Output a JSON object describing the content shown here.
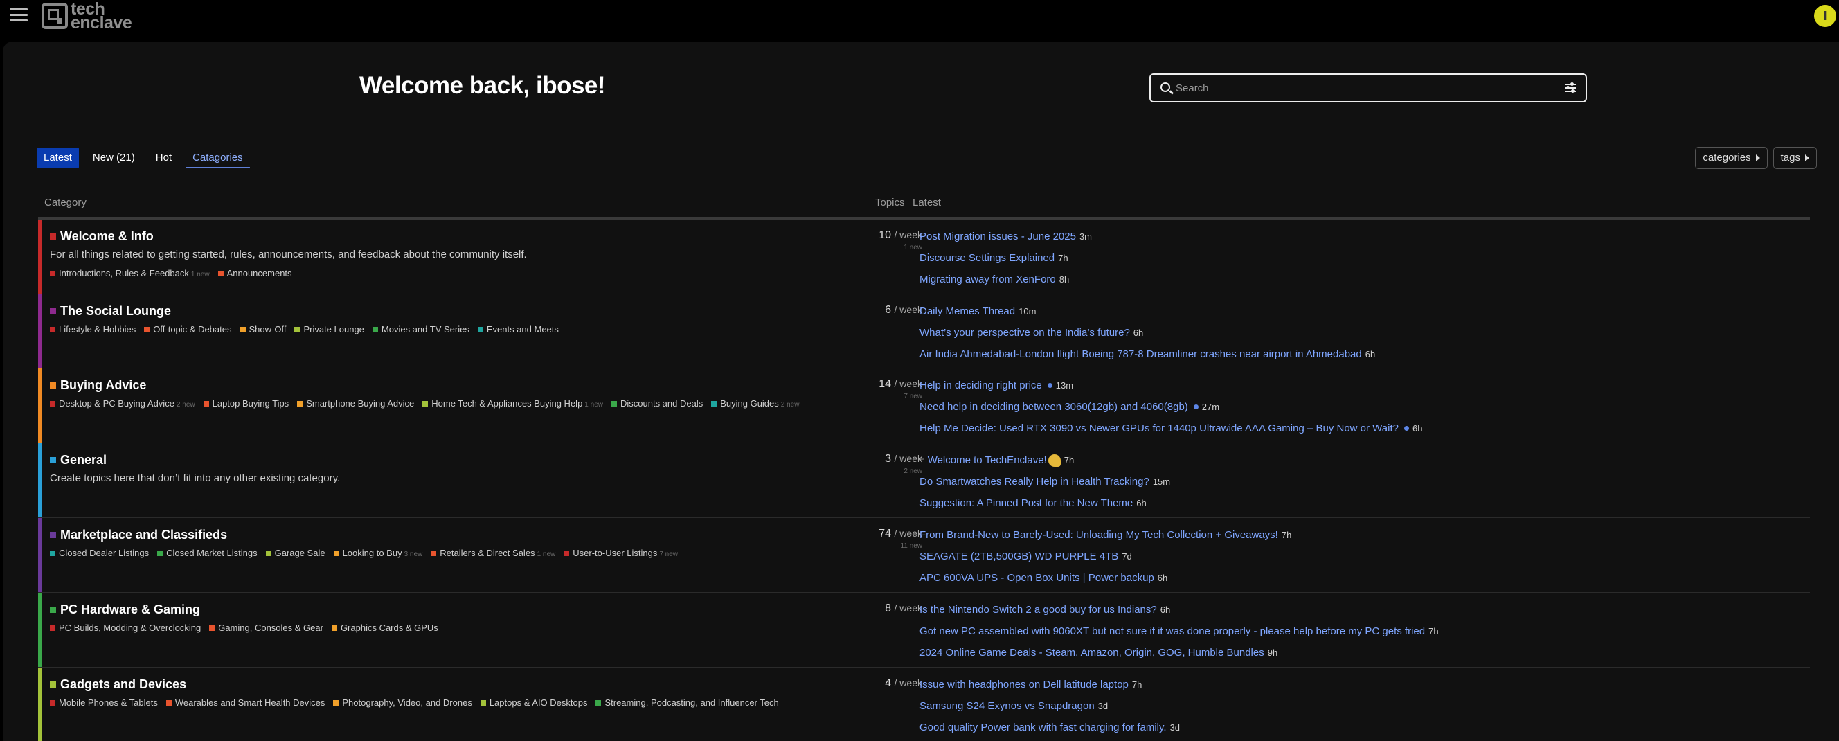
{
  "header": {
    "logo_text_1": "tech",
    "logo_text_2": "enclave",
    "avatar_letter": "I"
  },
  "welcome": "Welcome back, ibose!",
  "search": {
    "placeholder": "Search"
  },
  "tabs": [
    {
      "label": "Latest"
    },
    {
      "label": "New (21)"
    },
    {
      "label": "Hot"
    },
    {
      "label": "Catagories"
    }
  ],
  "crumbs": {
    "categories": "categories",
    "tags": "tags"
  },
  "table": {
    "col_category": "Category",
    "col_topics": "Topics",
    "col_latest": "Latest"
  },
  "categories": [
    {
      "name": "Welcome & Info",
      "color": "#c62a2a",
      "description": "For all things related to getting started, rules, announcements, and feedback about the community itself.",
      "subcategories": [
        {
          "name": "Introductions, Rules & Feedback",
          "color": "#c62a2a",
          "new": "1 new"
        },
        {
          "name": "Announcements",
          "color": "#e8542e",
          "new": ""
        }
      ],
      "topics": "10",
      "per": "/ week",
      "new": "1 new",
      "latest": [
        {
          "title": "Post Migration issues - June 2025",
          "age": "3m"
        },
        {
          "title": "Discourse Settings Explained",
          "age": "7h"
        },
        {
          "title": "Migrating away from XenForo",
          "age": "8h"
        }
      ]
    },
    {
      "name": "The Social Lounge",
      "color": "#8e2a8e",
      "description": "",
      "subcategories": [
        {
          "name": "Lifestyle & Hobbies",
          "color": "#c62a2a",
          "new": ""
        },
        {
          "name": "Off-topic & Debates",
          "color": "#e8542e",
          "new": ""
        },
        {
          "name": "Show-Off",
          "color": "#f0a02a",
          "new": ""
        },
        {
          "name": "Private Lounge",
          "color": "#a3c23a",
          "new": ""
        },
        {
          "name": "Movies and TV Series",
          "color": "#3aa84a",
          "new": ""
        },
        {
          "name": "Events and Meets",
          "color": "#1fa6a0",
          "new": ""
        }
      ],
      "topics": "6",
      "per": "/ week",
      "new": "",
      "latest": [
        {
          "title": "Daily Memes Thread",
          "age": "10m"
        },
        {
          "title": "What’s your perspective on the India’s future?",
          "age": "6h"
        },
        {
          "title": "Air India Ahmedabad-London flight Boeing 787-8 Dreamliner crashes near airport in Ahmedabad",
          "age": "6h"
        }
      ]
    },
    {
      "name": "Buying Advice",
      "color": "#f08a24",
      "description": "",
      "subcategories": [
        {
          "name": "Desktop & PC Buying Advice",
          "color": "#c62a2a",
          "new": "2 new"
        },
        {
          "name": "Laptop Buying Tips",
          "color": "#e8542e",
          "new": ""
        },
        {
          "name": "Smartphone Buying Advice",
          "color": "#f0a02a",
          "new": ""
        },
        {
          "name": "Home Tech & Appliances Buying Help",
          "color": "#a3c23a",
          "new": "1 new"
        },
        {
          "name": "Discounts and Deals",
          "color": "#3aa84a",
          "new": ""
        },
        {
          "name": "Buying Guides",
          "color": "#1fa6a0",
          "new": "2 new"
        }
      ],
      "topics": "14",
      "per": "/ week",
      "new": "7 new",
      "latest": [
        {
          "title": "Help in deciding right price",
          "age": "13m",
          "dot": true
        },
        {
          "title": "Need help in deciding between 3060(12gb) and 4060(8gb)",
          "age": "27m",
          "dot": true
        },
        {
          "title": "Help Me Decide: Used RTX 3090 vs Newer GPUs for 1440p Ultrawide AAA Gaming – Buy Now or Wait?",
          "age": "6h",
          "dot": true
        }
      ]
    },
    {
      "name": "General",
      "color": "#2aa0d8",
      "description": "Create topics here that don’t fit into any other existing category.",
      "subcategories": [],
      "topics": "3",
      "per": "/ week",
      "new": "2 new",
      "latest": [
        {
          "title": "Welcome to TechEnclave!",
          "age": "7h",
          "pinned": true,
          "emoji": true
        },
        {
          "title": "Do Smartwatches Really Help in Health Tracking?",
          "age": "15m"
        },
        {
          "title": "Suggestion: A Pinned Post for the New Theme",
          "age": "6h"
        }
      ]
    },
    {
      "name": "Marketplace and Classifieds",
      "color": "#6a3a9a",
      "description": "",
      "subcategories": [
        {
          "name": "Closed Dealer Listings",
          "color": "#1fa6a0",
          "new": ""
        },
        {
          "name": "Closed Market Listings",
          "color": "#3aa84a",
          "new": ""
        },
        {
          "name": "Garage Sale",
          "color": "#a3c23a",
          "new": ""
        },
        {
          "name": "Looking to Buy",
          "color": "#f0a02a",
          "new": "3 new"
        },
        {
          "name": "Retailers & Direct Sales",
          "color": "#e8542e",
          "new": "1 new"
        },
        {
          "name": "User-to-User Listings",
          "color": "#c62a2a",
          "new": "7 new"
        }
      ],
      "topics": "74",
      "per": "/ week",
      "new": "11 new",
      "latest": [
        {
          "title": "From Brand-New to Barely-Used: Unloading My Tech Collection + Giveaways!",
          "age": "7h"
        },
        {
          "title": "SEAGATE (2TB,500GB) WD PURPLE 4TB",
          "age": "7d"
        },
        {
          "title": "APC 600VA UPS - Open Box Units | Power backup",
          "age": "6h"
        }
      ]
    },
    {
      "name": "PC Hardware & Gaming",
      "color": "#3aa84a",
      "description": "",
      "subcategories": [
        {
          "name": "PC Builds, Modding & Overclocking",
          "color": "#c62a2a",
          "new": ""
        },
        {
          "name": "Gaming, Consoles & Gear",
          "color": "#e8542e",
          "new": ""
        },
        {
          "name": "Graphics Cards & GPUs",
          "color": "#f0a02a",
          "new": ""
        }
      ],
      "topics": "8",
      "per": "/ week",
      "new": "",
      "latest": [
        {
          "title": "Is the Nintendo Switch 2 a good buy for us Indians?",
          "age": "6h"
        },
        {
          "title": "Got new PC assembled with 9060XT but not sure if it was done properly - please help before my PC gets fried",
          "age": "7h"
        },
        {
          "title": "2024 Online Game Deals - Steam, Amazon, Origin, GOG, Humble Bundles",
          "age": "9h"
        }
      ]
    },
    {
      "name": "Gadgets and Devices",
      "color": "#a3c23a",
      "description": "",
      "subcategories": [
        {
          "name": "Mobile Phones & Tablets",
          "color": "#c62a2a",
          "new": ""
        },
        {
          "name": "Wearables and Smart Health Devices",
          "color": "#e8542e",
          "new": ""
        },
        {
          "name": "Photography, Video, and Drones",
          "color": "#f0a02a",
          "new": ""
        },
        {
          "name": "Laptops & AIO Desktops",
          "color": "#a3c23a",
          "new": ""
        },
        {
          "name": "Streaming, Podcasting, and Influencer Tech",
          "color": "#3aa84a",
          "new": ""
        }
      ],
      "topics": "4",
      "per": "/ week",
      "new": "",
      "latest": [
        {
          "title": "Issue with headphones on Dell latitude laptop",
          "age": "7h"
        },
        {
          "title": "Samsung S24 Exynos vs Snapdragon",
          "age": "3d"
        },
        {
          "title": "Good quality Power bank with fast charging for family.",
          "age": "3d"
        }
      ]
    }
  ]
}
